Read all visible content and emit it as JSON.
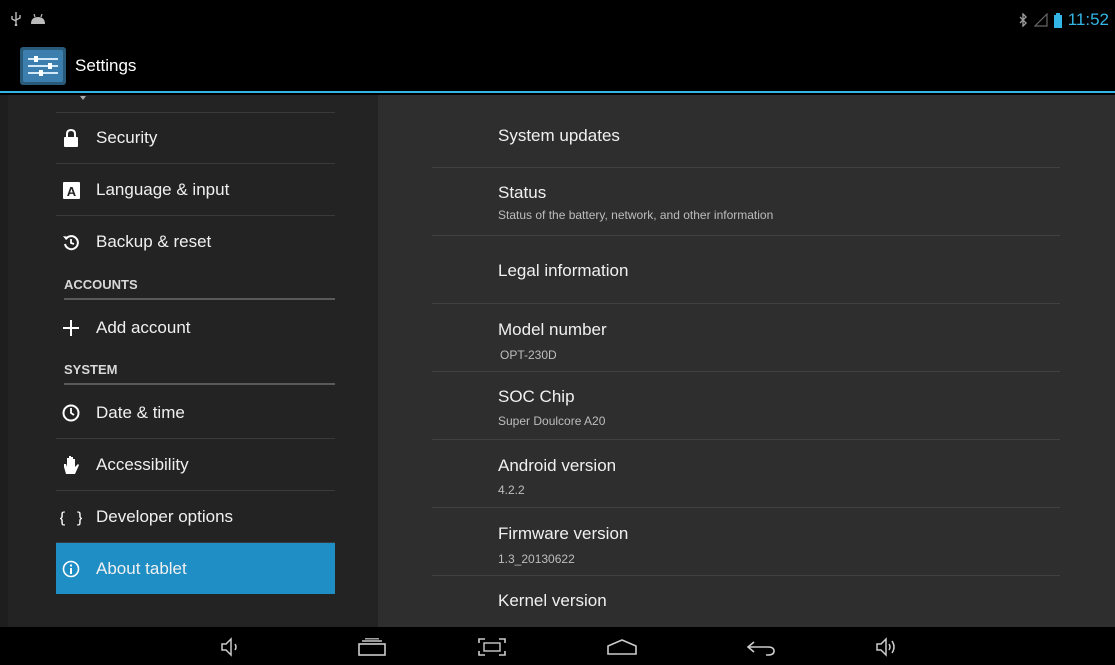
{
  "status_bar": {
    "time": "11:52",
    "left_icons": [
      "usb-icon",
      "android-debug-icon"
    ],
    "right_icons": [
      "bluetooth-icon",
      "signal-icon",
      "battery-icon"
    ]
  },
  "action_bar": {
    "title": "Settings",
    "icon": "settings-sliders-icon"
  },
  "sidebar": {
    "items": [
      {
        "label": "Security",
        "icon": "lock-icon"
      },
      {
        "label": "Language & input",
        "icon": "language-icon"
      },
      {
        "label": "Backup & reset",
        "icon": "backup-icon"
      },
      {
        "label": "Add account",
        "icon": "plus-icon"
      },
      {
        "label": "Date & time",
        "icon": "clock-icon"
      },
      {
        "label": "Accessibility",
        "icon": "hand-icon"
      },
      {
        "label": "Developer options",
        "icon": "braces-icon"
      },
      {
        "label": "About tablet",
        "icon": "info-icon",
        "selected": true
      }
    ],
    "headers": [
      "ACCOUNTS",
      "SYSTEM"
    ]
  },
  "detail": {
    "items": [
      {
        "title": "System updates",
        "subtitle": ""
      },
      {
        "title": "Status",
        "subtitle": "Status of the battery, network, and other information"
      },
      {
        "title": "Legal information",
        "subtitle": ""
      },
      {
        "title": "Model number",
        "subtitle": "OPT-230D"
      },
      {
        "title": "SOC Chip",
        "subtitle": "Super Doulcore A20"
      },
      {
        "title": "Android version",
        "subtitle": "4.2.2"
      },
      {
        "title": "Firmware version",
        "subtitle": "1.3_20130622"
      },
      {
        "title": "Kernel version",
        "subtitle": ""
      }
    ]
  },
  "nav_bar": {
    "buttons": [
      "volume-down-icon",
      "recent-apps-icon",
      "screenshot-icon",
      "home-icon",
      "back-icon",
      "volume-up-icon"
    ]
  },
  "colors": {
    "accent": "#33b5e5",
    "selected": "#1f8ec4"
  }
}
